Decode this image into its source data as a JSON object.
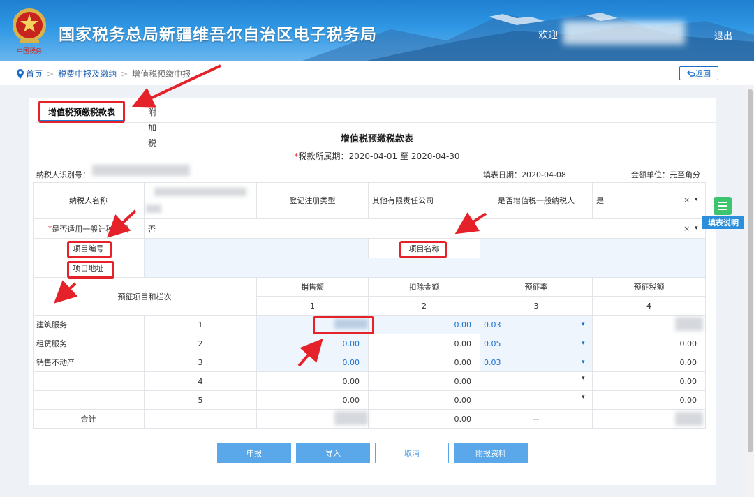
{
  "header": {
    "title": "国家税务总局新疆维吾尔自治区电子税务局",
    "welcome": "欢迎",
    "logout": "退出",
    "emblem_text": "中国税务"
  },
  "breadcrumb": {
    "home": "首页",
    "section": "税费申报及缴纳",
    "current": "增值税预缴申报",
    "sep": ">",
    "back": "返回"
  },
  "tabs": [
    {
      "label": "增值税预缴税款表",
      "active": true
    },
    {
      "label": "附加税",
      "active": false
    }
  ],
  "form": {
    "title": "增值税预缴税款表",
    "period_prefix": "*",
    "period_label": "税款所属期：",
    "period_value": "2020-04-01 至 2020-04-30",
    "taxpayer_id_label": "纳税人识别号：",
    "fill_date": "填表日期：2020-04-08",
    "unit": "金额单位：元至角分"
  },
  "info": {
    "taxpayer_name_label": "纳税人名称",
    "reg_type_label": "登记注册类型",
    "reg_type_value": "其他有限责任公司",
    "general_taxpayer_label": "是否增值税一般纳税人",
    "general_taxpayer_value": "是",
    "general_method_prefix": "*",
    "general_method_label": "是否适用一般计税方式",
    "general_method_value": "否",
    "project_no_label": "项目编号",
    "project_name_label": "项目名称",
    "project_addr_label": "项目地址",
    "clear_icon": "×",
    "dropdown_icon": "▾"
  },
  "table": {
    "item_header": "预征项目和栏次",
    "columns": [
      {
        "label": "销售额",
        "index": "1"
      },
      {
        "label": "扣除金额",
        "index": "2"
      },
      {
        "label": "预征率",
        "index": "3"
      },
      {
        "label": "预征税额",
        "index": "4"
      }
    ],
    "rows": [
      {
        "name": "建筑服务",
        "no": "1",
        "sales": "",
        "deduction": "0.00",
        "rate": "0.03",
        "tax": ""
      },
      {
        "name": "租赁服务",
        "no": "2",
        "sales": "0.00",
        "deduction": "0.00",
        "rate": "0.05",
        "tax": "0.00"
      },
      {
        "name": "销售不动产",
        "no": "3",
        "sales": "0.00",
        "deduction": "0.00",
        "rate": "0.03",
        "tax": "0.00"
      },
      {
        "name": "",
        "no": "4",
        "sales": "0.00",
        "deduction": "0.00",
        "rate": "",
        "tax": "0.00"
      },
      {
        "name": "",
        "no": "5",
        "sales": "0.00",
        "deduction": "0.00",
        "rate": "",
        "tax": "0.00"
      }
    ],
    "total": {
      "label": "合计",
      "sales": "",
      "deduction": "0.00",
      "rate": "--",
      "tax": ""
    }
  },
  "buttons": {
    "submit": "申报",
    "import": "导入",
    "cancel": "取消",
    "attach": "附报资料"
  },
  "help": {
    "label": "填表说明"
  },
  "colors": {
    "primary": "#5aa7ea",
    "link": "#1a5fb4",
    "annotation": "#e5222a",
    "help_icon": "#3cc46e"
  }
}
